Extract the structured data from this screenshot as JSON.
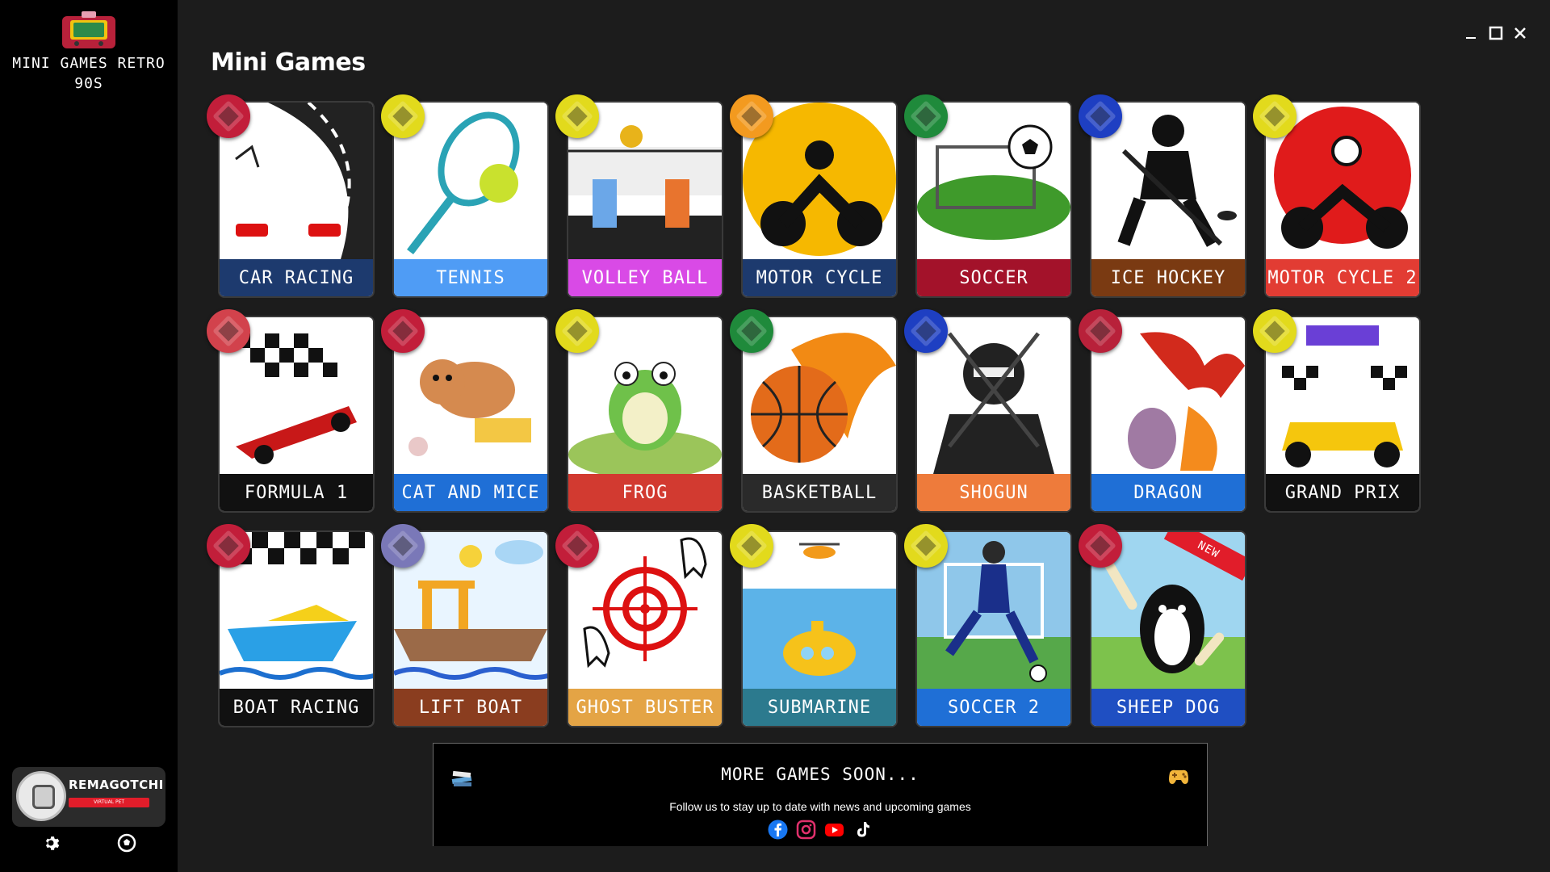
{
  "app": {
    "title": "MINI GAMES RETRO 90S"
  },
  "header": {
    "title": "Mini Games"
  },
  "window_controls": [
    "minimize",
    "maximize",
    "close"
  ],
  "games": [
    {
      "label": "CAR RACING",
      "label_color": "#1d3a6e",
      "badge_color": "#c21e3a",
      "art": "car-racing"
    },
    {
      "label": "TENNIS",
      "label_color": "#4f9cf5",
      "badge_color": "#e2da1c",
      "art": "tennis"
    },
    {
      "label": "VOLLEY BALL",
      "label_color": "#d94ae6",
      "badge_color": "#e2da1c",
      "art": "volleyball"
    },
    {
      "label": "MOTOR CYCLE",
      "label_color": "#1d3a6e",
      "badge_color": "#f39a1f",
      "art": "motorcycle"
    },
    {
      "label": "SOCCER",
      "label_color": "#a3122a",
      "badge_color": "#1f8a3b",
      "art": "soccer"
    },
    {
      "label": "ICE HOCKEY",
      "label_color": "#7a3a12",
      "badge_color": "#1e3fc2",
      "art": "ice-hockey"
    },
    {
      "label": "MOTOR CYCLE 2",
      "label_color": "#e23c33",
      "badge_color": "#e2da1c",
      "art": "motorcycle-2"
    },
    {
      "label": "FORMULA 1",
      "label_color": "#111111",
      "badge_color": "#d2424c",
      "art": "formula-1"
    },
    {
      "label": "CAT AND MICE",
      "label_color": "#1f6fd6",
      "badge_color": "#c21e3a",
      "art": "cat-mice"
    },
    {
      "label": "FROG",
      "label_color": "#d23a30",
      "badge_color": "#e2da1c",
      "art": "frog"
    },
    {
      "label": "BASKETBALL",
      "label_color": "#2a2a2a",
      "badge_color": "#1f8a3b",
      "art": "basketball"
    },
    {
      "label": "SHOGUN",
      "label_color": "#ee7b3b",
      "badge_color": "#1e3fc2",
      "art": "shogun"
    },
    {
      "label": "DRAGON",
      "label_color": "#1f6fd6",
      "badge_color": "#b8213a",
      "art": "dragon"
    },
    {
      "label": "GRAND PRIX",
      "label_color": "#111111",
      "badge_color": "#e2da1c",
      "art": "grand-prix"
    },
    {
      "label": "BOAT RACING",
      "label_color": "#111111",
      "badge_color": "#c21e3a",
      "art": "boat-racing"
    },
    {
      "label": "LIFT BOAT",
      "label_color": "#8a3d1f",
      "badge_color": "#7a78b8",
      "art": "lift-boat"
    },
    {
      "label": "GHOST BUSTER",
      "label_color": "#e4a445",
      "badge_color": "#c21e3a",
      "art": "ghost-buster"
    },
    {
      "label": "SUBMARINE",
      "label_color": "#2c7a8e",
      "badge_color": "#e2da1c",
      "art": "submarine"
    },
    {
      "label": "SOCCER 2",
      "label_color": "#1f6fd6",
      "badge_color": "#e2da1c",
      "art": "soccer-2"
    },
    {
      "label": "SHEEP DOG",
      "label_color": "#1f4fc2",
      "badge_color": "#c21e3a",
      "art": "sheep-dog",
      "ribbon": "NEW"
    }
  ],
  "banner": {
    "title": "MORE GAMES SOON...",
    "subtitle": "Follow us to stay up to date with news and upcoming games",
    "socials": [
      "facebook",
      "instagram",
      "youtube",
      "tiktok"
    ]
  },
  "remagotchi": {
    "title": "REMAGOTCHI",
    "subtitle": "VIRTUAL PET"
  },
  "sidebar_footer": [
    "gear-icon",
    "soccer-ball-icon"
  ]
}
